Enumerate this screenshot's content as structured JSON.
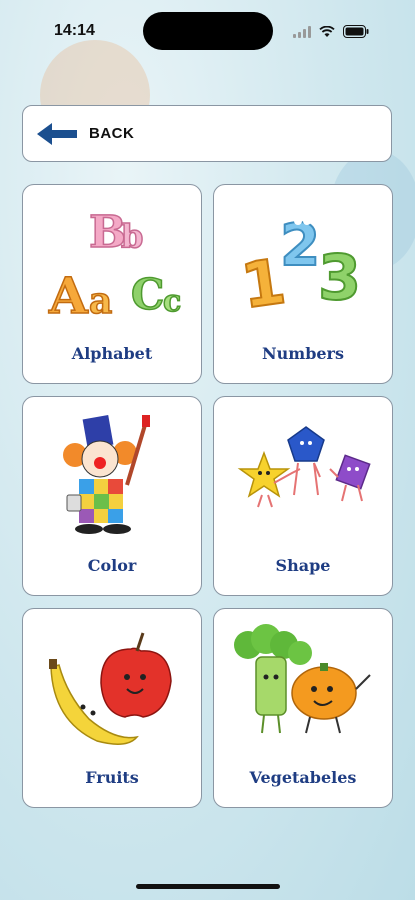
{
  "status_bar": {
    "time": "14:14",
    "icons": [
      "signal-icon",
      "wifi-icon",
      "battery-icon"
    ]
  },
  "back": {
    "label": "BACK",
    "icon": "arrow-left-icon"
  },
  "categories": [
    {
      "label": "Alphabet",
      "icon": "alphabet-letters-illustration"
    },
    {
      "label": "Numbers",
      "icon": "numbers-illustration"
    },
    {
      "label": "Color",
      "icon": "clown-painter-illustration"
    },
    {
      "label": "Shape",
      "icon": "shapes-illustration"
    },
    {
      "label": "Fruits",
      "icon": "fruits-illustration"
    },
    {
      "label": "Vegetabeles",
      "icon": "vegetables-illustration"
    }
  ],
  "colors": {
    "label": "#1f3d83",
    "back_arrow": "#1b4f8f",
    "card_border": "#8a96a3"
  }
}
